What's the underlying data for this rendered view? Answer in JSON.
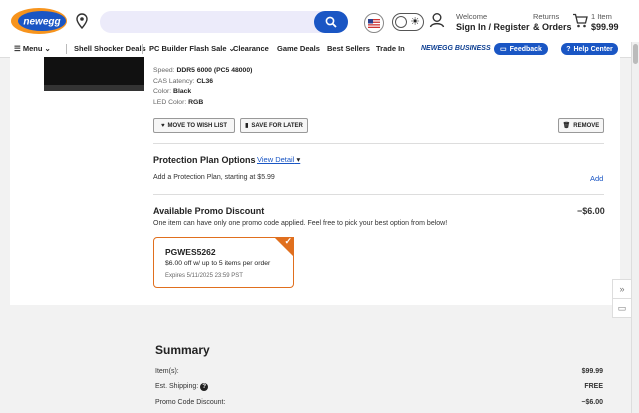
{
  "header": {
    "logo_text": "newegg",
    "search_placeholder": "",
    "welcome": "Welcome",
    "signin": "Sign In / Register",
    "returns": "Returns",
    "orders": "& Orders",
    "cart_count": "1 Item",
    "cart_total": "$99.99",
    "accent": "#1a56c4",
    "brand_orange": "#f7941d"
  },
  "nav": {
    "menu": "Menu",
    "items": [
      "Shell Shocker Deals",
      "PC Builder Flash Sale",
      "Clearance",
      "Game Deals",
      "Best Sellers",
      "Trade In"
    ],
    "business": "NEWEGG BUSINESS",
    "feedback": "Feedback",
    "help": "Help Center"
  },
  "product": {
    "specs": [
      {
        "label": "Speed:",
        "value": "DDR5 6000 (PC5 48000)"
      },
      {
        "label": "CAS Latency:",
        "value": "CL36"
      },
      {
        "label": "Color:",
        "value": "Black"
      },
      {
        "label": "LED Color:",
        "value": "RGB"
      }
    ],
    "wishlist": "MOVE TO WISH LIST",
    "savelater": "SAVE FOR LATER",
    "remove": "REMOVE"
  },
  "protection": {
    "title": "Protection Plan Options",
    "view_detail": "View Detail",
    "text": "Add a Protection Plan, starting at",
    "price": "$5.99",
    "add": "Add"
  },
  "promo": {
    "title": "Available Promo Discount",
    "amount": "−$6.00",
    "note": "One item can have only one promo code applied. Feel free to pick your best option from below!",
    "code": "PGWES5262",
    "desc": "$6.00 off w/ up to 5 items per order",
    "expires": "Expires 5/11/2025 23:59 PST",
    "color": "#e06f1e"
  },
  "summary": {
    "title": "Summary",
    "rows": [
      {
        "label": "Item(s):",
        "value": "$99.99"
      },
      {
        "label": "Est. Shipping:",
        "value": "FREE"
      },
      {
        "label": "Promo Code Discount:",
        "value": "−$6.00"
      }
    ]
  }
}
